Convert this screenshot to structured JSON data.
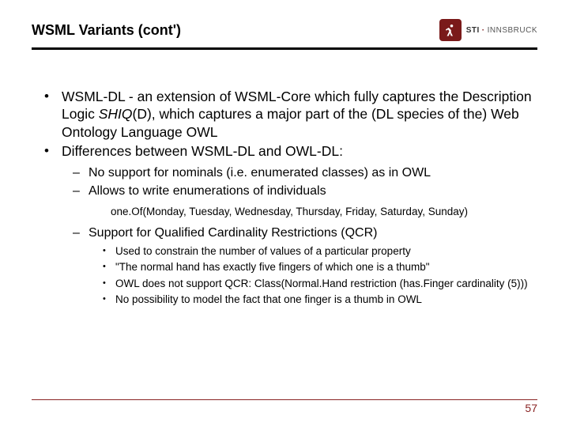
{
  "header": {
    "title": "WSML Variants (cont')",
    "logo": {
      "sti": "STI",
      "dot": "·",
      "inns": "INNSBRUCK"
    }
  },
  "bullets": {
    "b1_pre": "WSML-DL - an extension of WSML-Core which fully captures the Description Logic ",
    "b1_ital": "SHIQ",
    "b1_post": "(D), which captures a major part of the (DL species of the) Web Ontology Language OWL",
    "b2": "Differences between WSML-DL and OWL-DL:",
    "s1": "No support for nominals (i.e. enumerated classes) as in OWL",
    "s2": "Allows to write enumerations of individuals",
    "code": "one.Of(Monday, Tuesday, Wednesday, Thursday, Friday, Saturday, Sunday)",
    "s3": "Support for Qualified Cardinality Restrictions (QCR)",
    "t1": "Used to constrain the number of values of a particular property",
    "t2": "\"The normal hand has exactly five fingers of which one is a thumb\"",
    "t3": "OWL does not support QCR:  Class(Normal.Hand restriction (has.Finger cardinality (5)))",
    "t4": "No possibility to model the fact that one finger is a thumb in OWL"
  },
  "page": "57"
}
